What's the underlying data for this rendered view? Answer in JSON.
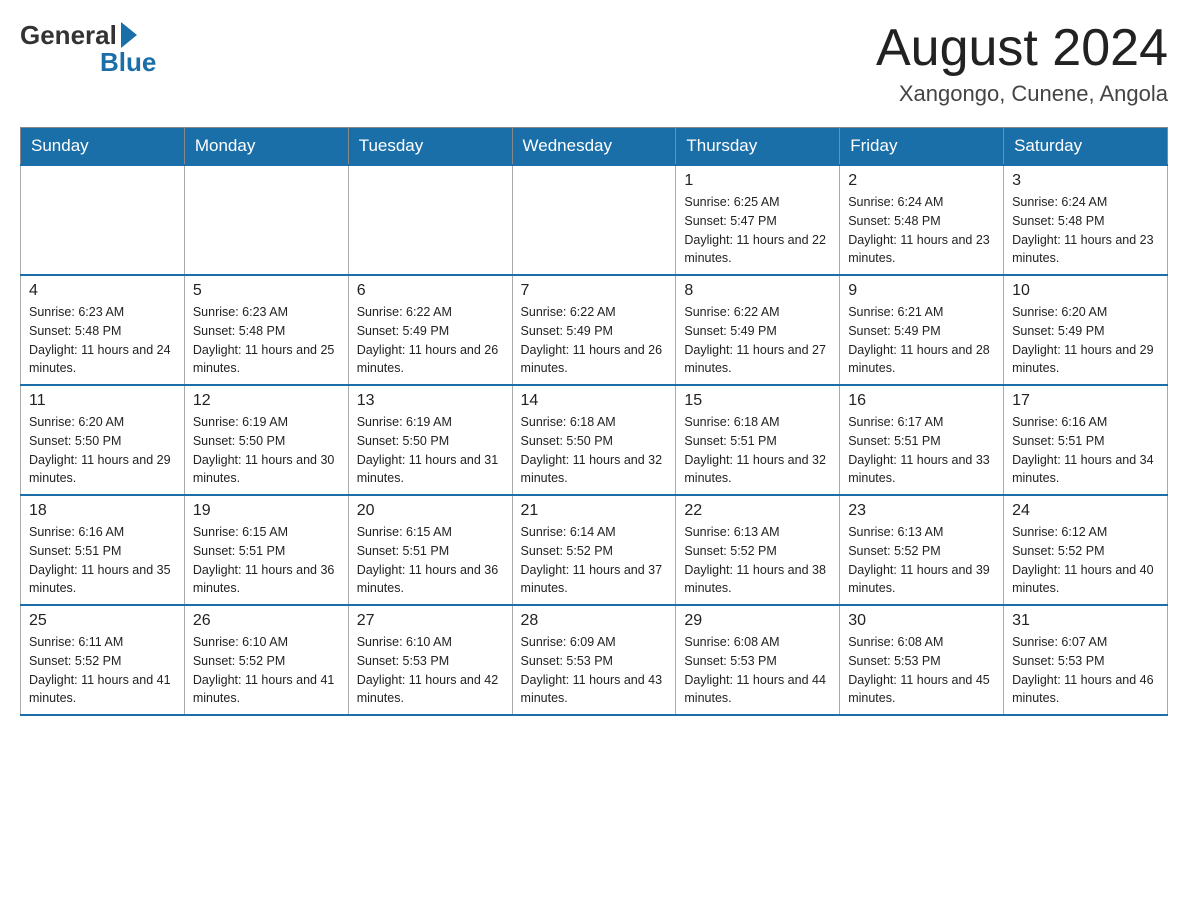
{
  "header": {
    "month_title": "August 2024",
    "location": "Xangongo, Cunene, Angola",
    "logo_general": "General",
    "logo_blue": "Blue"
  },
  "days_of_week": [
    "Sunday",
    "Monday",
    "Tuesday",
    "Wednesday",
    "Thursday",
    "Friday",
    "Saturday"
  ],
  "weeks": [
    [
      {
        "day": "",
        "sunrise": "",
        "sunset": "",
        "daylight": ""
      },
      {
        "day": "",
        "sunrise": "",
        "sunset": "",
        "daylight": ""
      },
      {
        "day": "",
        "sunrise": "",
        "sunset": "",
        "daylight": ""
      },
      {
        "day": "",
        "sunrise": "",
        "sunset": "",
        "daylight": ""
      },
      {
        "day": "1",
        "sunrise": "Sunrise: 6:25 AM",
        "sunset": "Sunset: 5:47 PM",
        "daylight": "Daylight: 11 hours and 22 minutes."
      },
      {
        "day": "2",
        "sunrise": "Sunrise: 6:24 AM",
        "sunset": "Sunset: 5:48 PM",
        "daylight": "Daylight: 11 hours and 23 minutes."
      },
      {
        "day": "3",
        "sunrise": "Sunrise: 6:24 AM",
        "sunset": "Sunset: 5:48 PM",
        "daylight": "Daylight: 11 hours and 23 minutes."
      }
    ],
    [
      {
        "day": "4",
        "sunrise": "Sunrise: 6:23 AM",
        "sunset": "Sunset: 5:48 PM",
        "daylight": "Daylight: 11 hours and 24 minutes."
      },
      {
        "day": "5",
        "sunrise": "Sunrise: 6:23 AM",
        "sunset": "Sunset: 5:48 PM",
        "daylight": "Daylight: 11 hours and 25 minutes."
      },
      {
        "day": "6",
        "sunrise": "Sunrise: 6:22 AM",
        "sunset": "Sunset: 5:49 PM",
        "daylight": "Daylight: 11 hours and 26 minutes."
      },
      {
        "day": "7",
        "sunrise": "Sunrise: 6:22 AM",
        "sunset": "Sunset: 5:49 PM",
        "daylight": "Daylight: 11 hours and 26 minutes."
      },
      {
        "day": "8",
        "sunrise": "Sunrise: 6:22 AM",
        "sunset": "Sunset: 5:49 PM",
        "daylight": "Daylight: 11 hours and 27 minutes."
      },
      {
        "day": "9",
        "sunrise": "Sunrise: 6:21 AM",
        "sunset": "Sunset: 5:49 PM",
        "daylight": "Daylight: 11 hours and 28 minutes."
      },
      {
        "day": "10",
        "sunrise": "Sunrise: 6:20 AM",
        "sunset": "Sunset: 5:49 PM",
        "daylight": "Daylight: 11 hours and 29 minutes."
      }
    ],
    [
      {
        "day": "11",
        "sunrise": "Sunrise: 6:20 AM",
        "sunset": "Sunset: 5:50 PM",
        "daylight": "Daylight: 11 hours and 29 minutes."
      },
      {
        "day": "12",
        "sunrise": "Sunrise: 6:19 AM",
        "sunset": "Sunset: 5:50 PM",
        "daylight": "Daylight: 11 hours and 30 minutes."
      },
      {
        "day": "13",
        "sunrise": "Sunrise: 6:19 AM",
        "sunset": "Sunset: 5:50 PM",
        "daylight": "Daylight: 11 hours and 31 minutes."
      },
      {
        "day": "14",
        "sunrise": "Sunrise: 6:18 AM",
        "sunset": "Sunset: 5:50 PM",
        "daylight": "Daylight: 11 hours and 32 minutes."
      },
      {
        "day": "15",
        "sunrise": "Sunrise: 6:18 AM",
        "sunset": "Sunset: 5:51 PM",
        "daylight": "Daylight: 11 hours and 32 minutes."
      },
      {
        "day": "16",
        "sunrise": "Sunrise: 6:17 AM",
        "sunset": "Sunset: 5:51 PM",
        "daylight": "Daylight: 11 hours and 33 minutes."
      },
      {
        "day": "17",
        "sunrise": "Sunrise: 6:16 AM",
        "sunset": "Sunset: 5:51 PM",
        "daylight": "Daylight: 11 hours and 34 minutes."
      }
    ],
    [
      {
        "day": "18",
        "sunrise": "Sunrise: 6:16 AM",
        "sunset": "Sunset: 5:51 PM",
        "daylight": "Daylight: 11 hours and 35 minutes."
      },
      {
        "day": "19",
        "sunrise": "Sunrise: 6:15 AM",
        "sunset": "Sunset: 5:51 PM",
        "daylight": "Daylight: 11 hours and 36 minutes."
      },
      {
        "day": "20",
        "sunrise": "Sunrise: 6:15 AM",
        "sunset": "Sunset: 5:51 PM",
        "daylight": "Daylight: 11 hours and 36 minutes."
      },
      {
        "day": "21",
        "sunrise": "Sunrise: 6:14 AM",
        "sunset": "Sunset: 5:52 PM",
        "daylight": "Daylight: 11 hours and 37 minutes."
      },
      {
        "day": "22",
        "sunrise": "Sunrise: 6:13 AM",
        "sunset": "Sunset: 5:52 PM",
        "daylight": "Daylight: 11 hours and 38 minutes."
      },
      {
        "day": "23",
        "sunrise": "Sunrise: 6:13 AM",
        "sunset": "Sunset: 5:52 PM",
        "daylight": "Daylight: 11 hours and 39 minutes."
      },
      {
        "day": "24",
        "sunrise": "Sunrise: 6:12 AM",
        "sunset": "Sunset: 5:52 PM",
        "daylight": "Daylight: 11 hours and 40 minutes."
      }
    ],
    [
      {
        "day": "25",
        "sunrise": "Sunrise: 6:11 AM",
        "sunset": "Sunset: 5:52 PM",
        "daylight": "Daylight: 11 hours and 41 minutes."
      },
      {
        "day": "26",
        "sunrise": "Sunrise: 6:10 AM",
        "sunset": "Sunset: 5:52 PM",
        "daylight": "Daylight: 11 hours and 41 minutes."
      },
      {
        "day": "27",
        "sunrise": "Sunrise: 6:10 AM",
        "sunset": "Sunset: 5:53 PM",
        "daylight": "Daylight: 11 hours and 42 minutes."
      },
      {
        "day": "28",
        "sunrise": "Sunrise: 6:09 AM",
        "sunset": "Sunset: 5:53 PM",
        "daylight": "Daylight: 11 hours and 43 minutes."
      },
      {
        "day": "29",
        "sunrise": "Sunrise: 6:08 AM",
        "sunset": "Sunset: 5:53 PM",
        "daylight": "Daylight: 11 hours and 44 minutes."
      },
      {
        "day": "30",
        "sunrise": "Sunrise: 6:08 AM",
        "sunset": "Sunset: 5:53 PM",
        "daylight": "Daylight: 11 hours and 45 minutes."
      },
      {
        "day": "31",
        "sunrise": "Sunrise: 6:07 AM",
        "sunset": "Sunset: 5:53 PM",
        "daylight": "Daylight: 11 hours and 46 minutes."
      }
    ]
  ]
}
